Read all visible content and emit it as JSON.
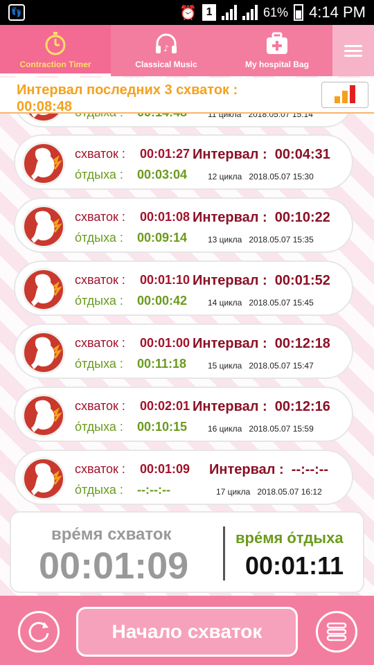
{
  "status_bar": {
    "battery_percent": "61%",
    "time": "4:14 PM",
    "sim_label": "1"
  },
  "tabs": [
    {
      "label": "Contraction Timer",
      "icon": "stopwatch-icon",
      "active": true
    },
    {
      "label": "Classical Music",
      "icon": "headphones-icon",
      "active": false
    },
    {
      "label": "My hospital Bag",
      "icon": "hospital-bag-icon",
      "active": false
    }
  ],
  "banner": {
    "label": "Интервал последних 3 схваток :",
    "value": "00:08:48"
  },
  "row_labels": {
    "contraction": "схваток :",
    "rest": "о́тдыха :",
    "interval": "Интервал :"
  },
  "rows": [
    {
      "contraction": "",
      "rest": "00:14:48",
      "interval": "",
      "cycle": "11 цикла",
      "datetime": "2018.05.07 15:14"
    },
    {
      "contraction": "00:01:27",
      "rest": "00:03:04",
      "interval": "00:04:31",
      "cycle": "12 цикла",
      "datetime": "2018.05.07 15:30"
    },
    {
      "contraction": "00:01:08",
      "rest": "00:09:14",
      "interval": "00:10:22",
      "cycle": "13 цикла",
      "datetime": "2018.05.07 15:35"
    },
    {
      "contraction": "00:01:10",
      "rest": "00:00:42",
      "interval": "00:01:52",
      "cycle": "14 цикла",
      "datetime": "2018.05.07 15:45"
    },
    {
      "contraction": "00:01:00",
      "rest": "00:11:18",
      "interval": "00:12:18",
      "cycle": "15 цикла",
      "datetime": "2018.05.07 15:47"
    },
    {
      "contraction": "00:02:01",
      "rest": "00:10:15",
      "interval": "00:12:16",
      "cycle": "16 цикла",
      "datetime": "2018.05.07 15:59"
    },
    {
      "contraction": "00:01:09",
      "rest": "--:--:--",
      "interval": "--:--:--",
      "cycle": "17 цикла",
      "datetime": "2018.05.07 16:12"
    }
  ],
  "summary": {
    "contraction_label": "вре́мя схваток",
    "contraction_time": "00:01:09",
    "rest_label": "вре́мя о́тдыха",
    "rest_time": "00:01:11"
  },
  "bottom": {
    "start_label": "Начало схваток",
    "reset_icon": "reset-icon",
    "list_icon": "list-icon"
  },
  "colors": {
    "pink": "#f37d9f",
    "contraction_red": "#a2122a",
    "rest_green": "#6a9a1c",
    "banner_orange": "#f4a11d"
  }
}
